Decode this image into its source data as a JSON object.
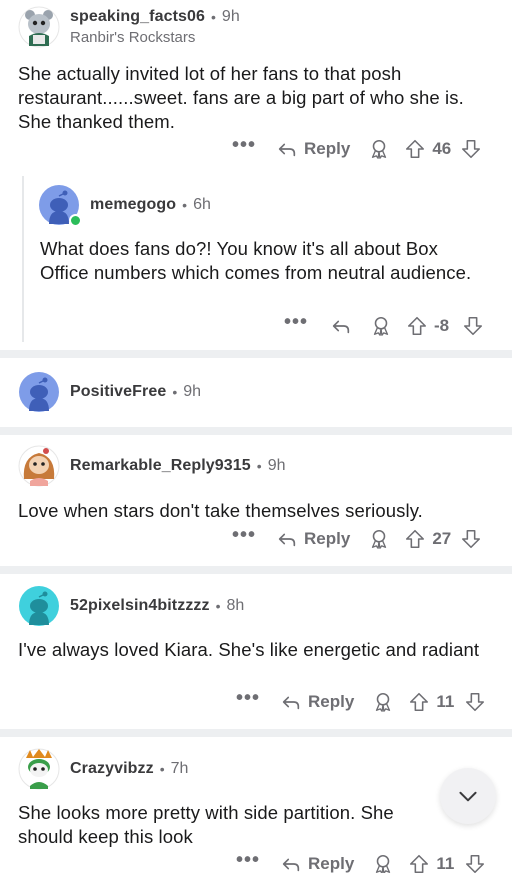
{
  "comments": [
    {
      "username": "speaking_facts06",
      "age": "9h",
      "flair": "Ranbir's Rockstars",
      "body": "She actually invited lot of her fans to that posh restaurant......sweet. fans are a big part of who she is. She thanked them.",
      "more": "•••",
      "reply": "Reply",
      "score": "46",
      "avatar_icon": "snoo-avatar-icon"
    },
    {
      "username": "memegogo",
      "age": "6h",
      "body": "What does fans do?! You know it's all about Box Office numbers which comes from neutral audience.",
      "more": "•••",
      "score": "-8",
      "avatar_icon": "default-snoo-icon"
    },
    {
      "username": "PositiveFree",
      "age": "9h",
      "avatar_icon": "default-snoo-icon"
    },
    {
      "username": "Remarkable_Reply9315",
      "age": "9h",
      "body": "Love when stars don't take themselves seriously.",
      "more": "•••",
      "reply": "Reply",
      "score": "27",
      "avatar_icon": "snoo-avatar-icon"
    },
    {
      "username": "52pixelsin4bitzzzz",
      "age": "8h",
      "body": "I've always loved Kiara. She's like energetic and radiant",
      "more": "•••",
      "reply": "Reply",
      "score": "11",
      "avatar_icon": "default-snoo-icon"
    },
    {
      "username": "Crazyvibzz",
      "age": "7h",
      "body": "She looks more pretty with side partition. She should keep this look",
      "more": "•••",
      "reply": "Reply",
      "score": "11",
      "avatar_icon": "snoo-avatar-icon"
    }
  ],
  "separator": "•",
  "colors": {
    "text": "#1a1a1b",
    "muted": "#6e6e73",
    "divider": "#edeff1",
    "online": "#2bbd5a",
    "snoo_blue": "#7e9ce8",
    "snoo_cyan": "#3fd0dd"
  },
  "icons": [
    "reply-arrow-icon",
    "award-icon",
    "upvote-icon",
    "downvote-icon",
    "chevron-down-icon"
  ]
}
